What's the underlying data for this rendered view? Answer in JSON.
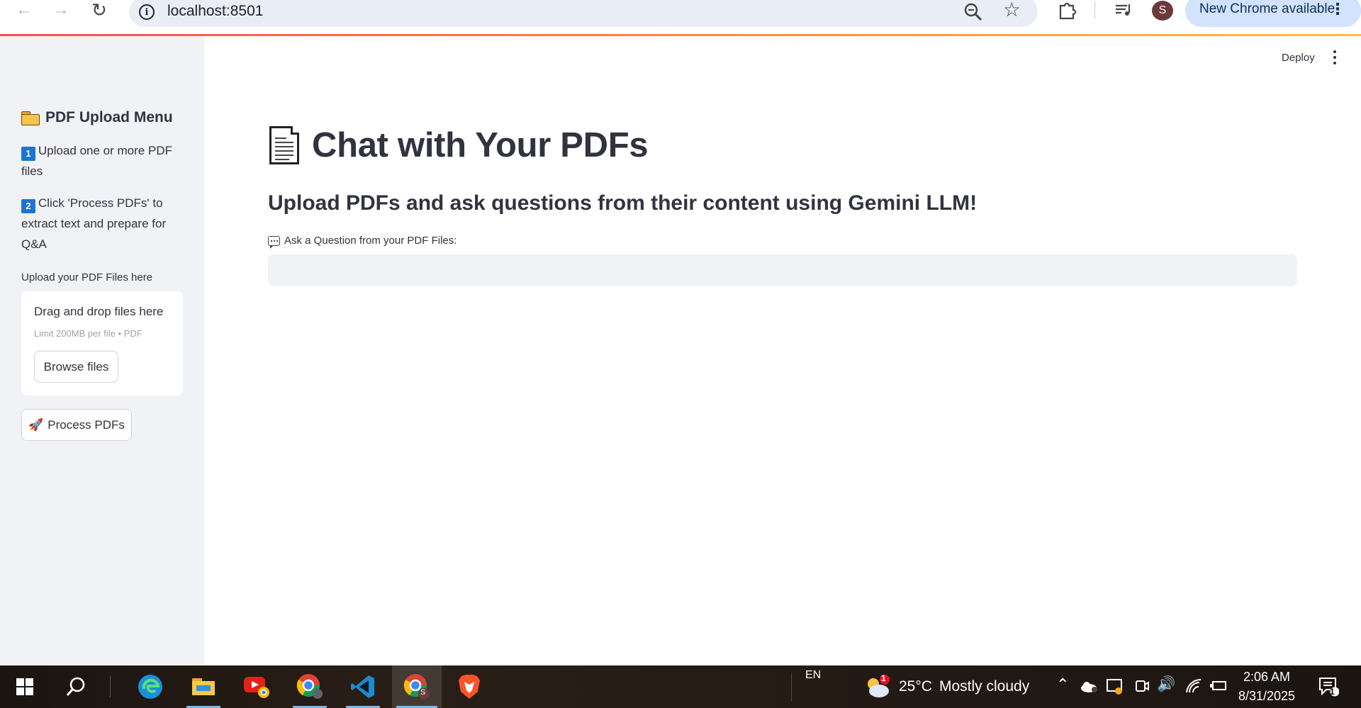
{
  "browser": {
    "url": "localhost:8501",
    "update_label": "New Chrome available",
    "avatar_initial": "S"
  },
  "sidebar": {
    "title": "PDF Upload Menu",
    "steps": [
      {
        "num": "1",
        "text": "Upload one or more PDF files"
      },
      {
        "num": "2",
        "text": "Click 'Process PDFs' to extract text and prepare for Q&A"
      }
    ],
    "upload_label": "Upload your PDF Files here",
    "dropzone_title": "Drag and drop files here",
    "dropzone_limit": "Limit 200MB per file • PDF",
    "browse_label": "Browse files",
    "process_label": "Process PDFs",
    "process_icon": "🚀"
  },
  "header": {
    "deploy_label": "Deploy"
  },
  "main": {
    "title": "Chat with Your PDFs",
    "subtitle": "Upload PDFs and ask questions from their content using Gemini LLM!",
    "question_label": "Ask a Question from your PDF Files:",
    "question_value": ""
  },
  "taskbar": {
    "language": "EN",
    "weather_badge": "1",
    "temperature": "25°C",
    "weather": "Mostly cloudy",
    "time": "2:06 AM",
    "date": "8/31/2025",
    "notification_count": "1",
    "chrome_profile_badge": "S"
  }
}
